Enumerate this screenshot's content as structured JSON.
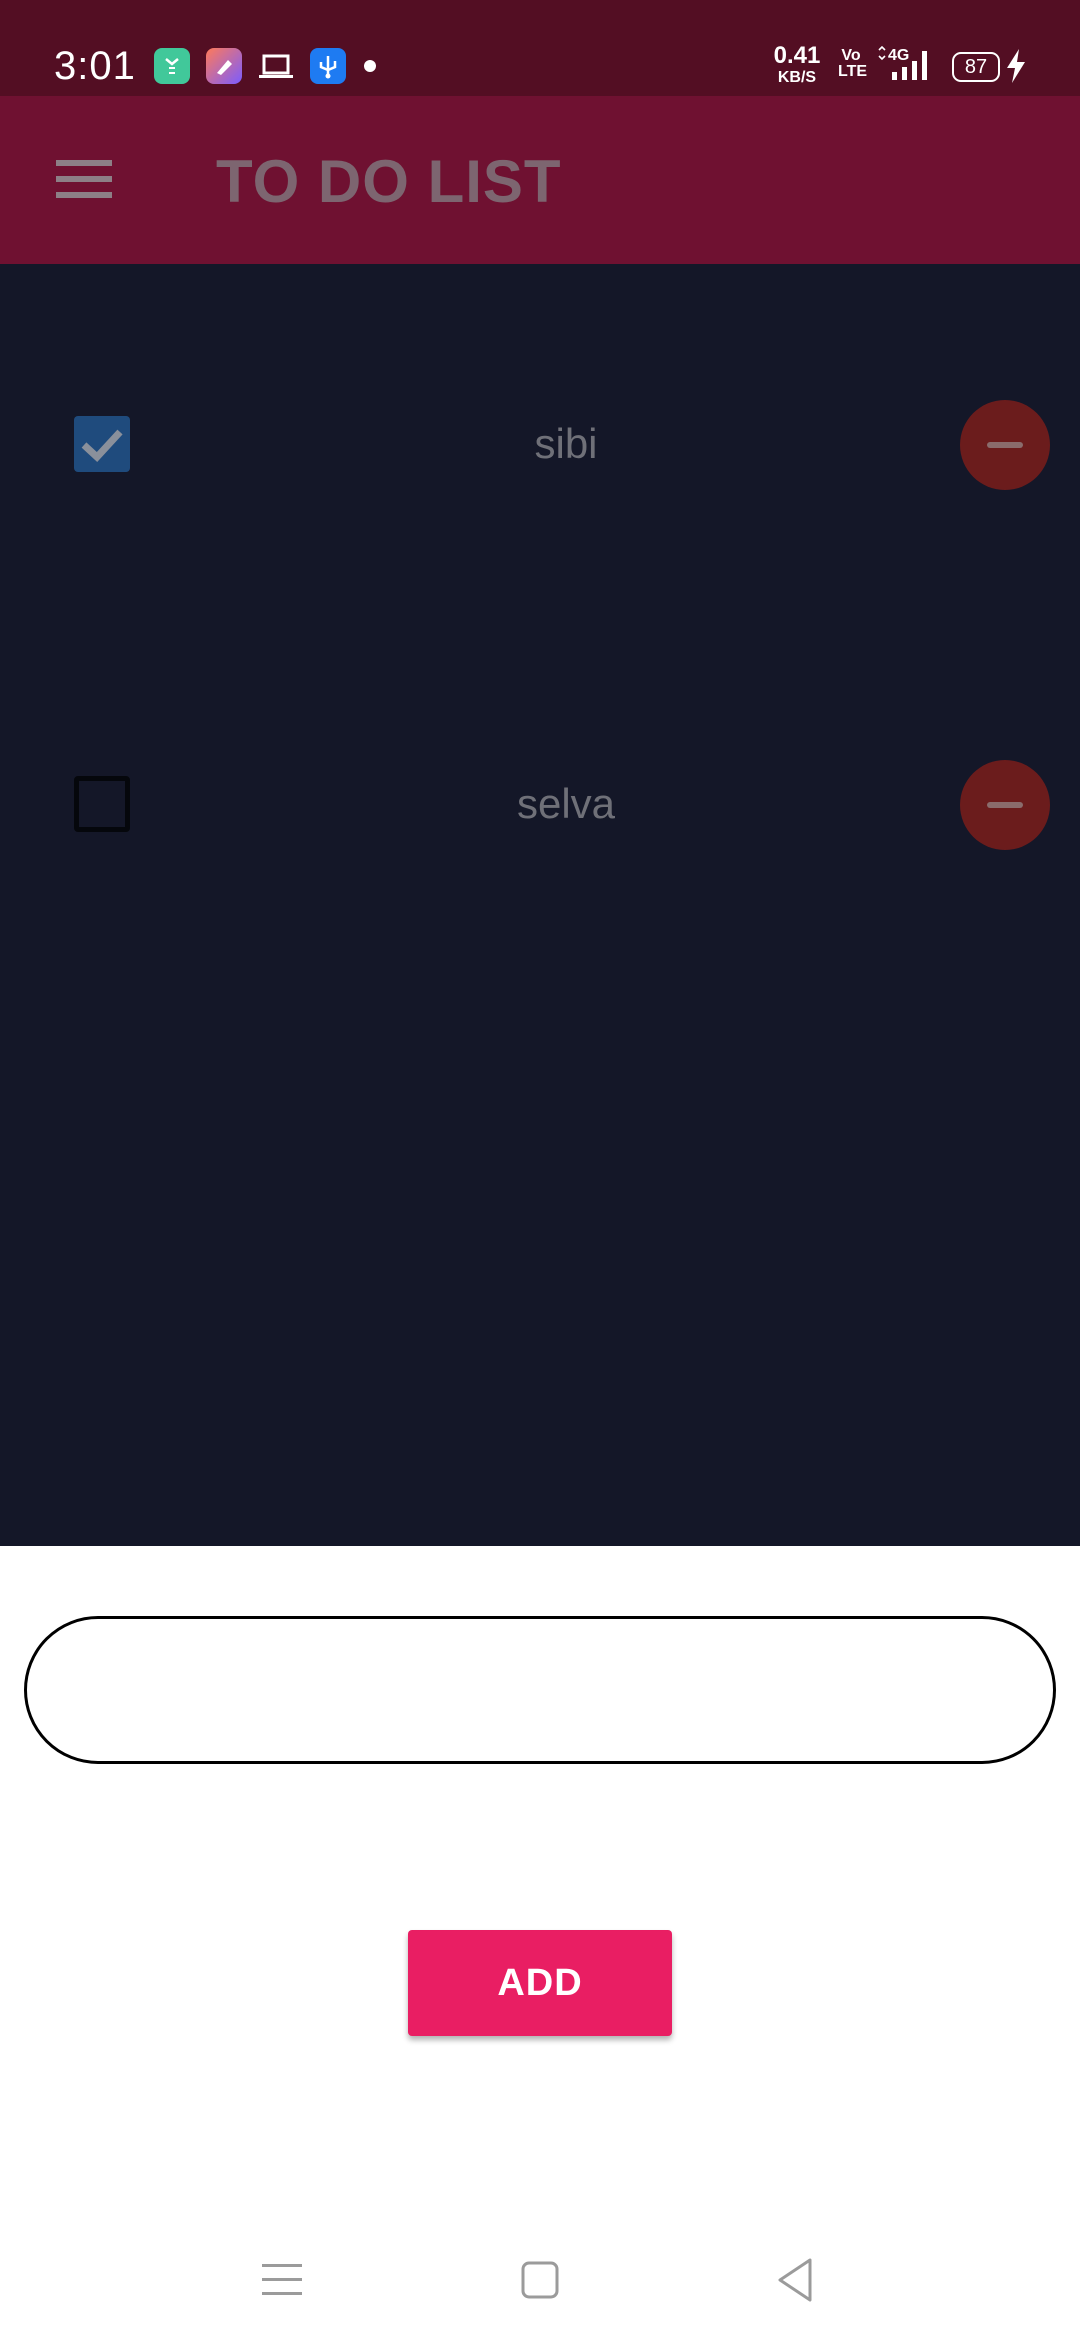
{
  "status_bar": {
    "time": "3:01",
    "net_speed_value": "0.41",
    "net_speed_unit": "KB/S",
    "volte_top": "Vo",
    "volte_bottom": "LTE",
    "network_type": "4G",
    "battery_level": "87",
    "icons": [
      "app-notification-icon",
      "editor-app-icon",
      "laptop-icon",
      "usb-icon",
      "notification-dot",
      "signal-icon",
      "battery-icon",
      "charging-bolt-icon"
    ]
  },
  "app_bar": {
    "title": "TO DO LIST",
    "menu_icon": "hamburger-menu-icon"
  },
  "todos": [
    {
      "label": "sibi",
      "checked": true
    },
    {
      "label": "selva",
      "checked": false
    }
  ],
  "input": {
    "value": "",
    "placeholder": ""
  },
  "add_button": {
    "label": "ADD"
  },
  "nav_bar": {
    "icons": [
      "recents-icon",
      "home-icon",
      "back-icon"
    ]
  },
  "colors": {
    "status_bar": "#530e23",
    "app_bar": "#6f1131",
    "list_background": "#141728",
    "add_button": "#e91e63",
    "checkbox_checked": "#1f4b7d",
    "remove_button": "#6b1c1c"
  }
}
